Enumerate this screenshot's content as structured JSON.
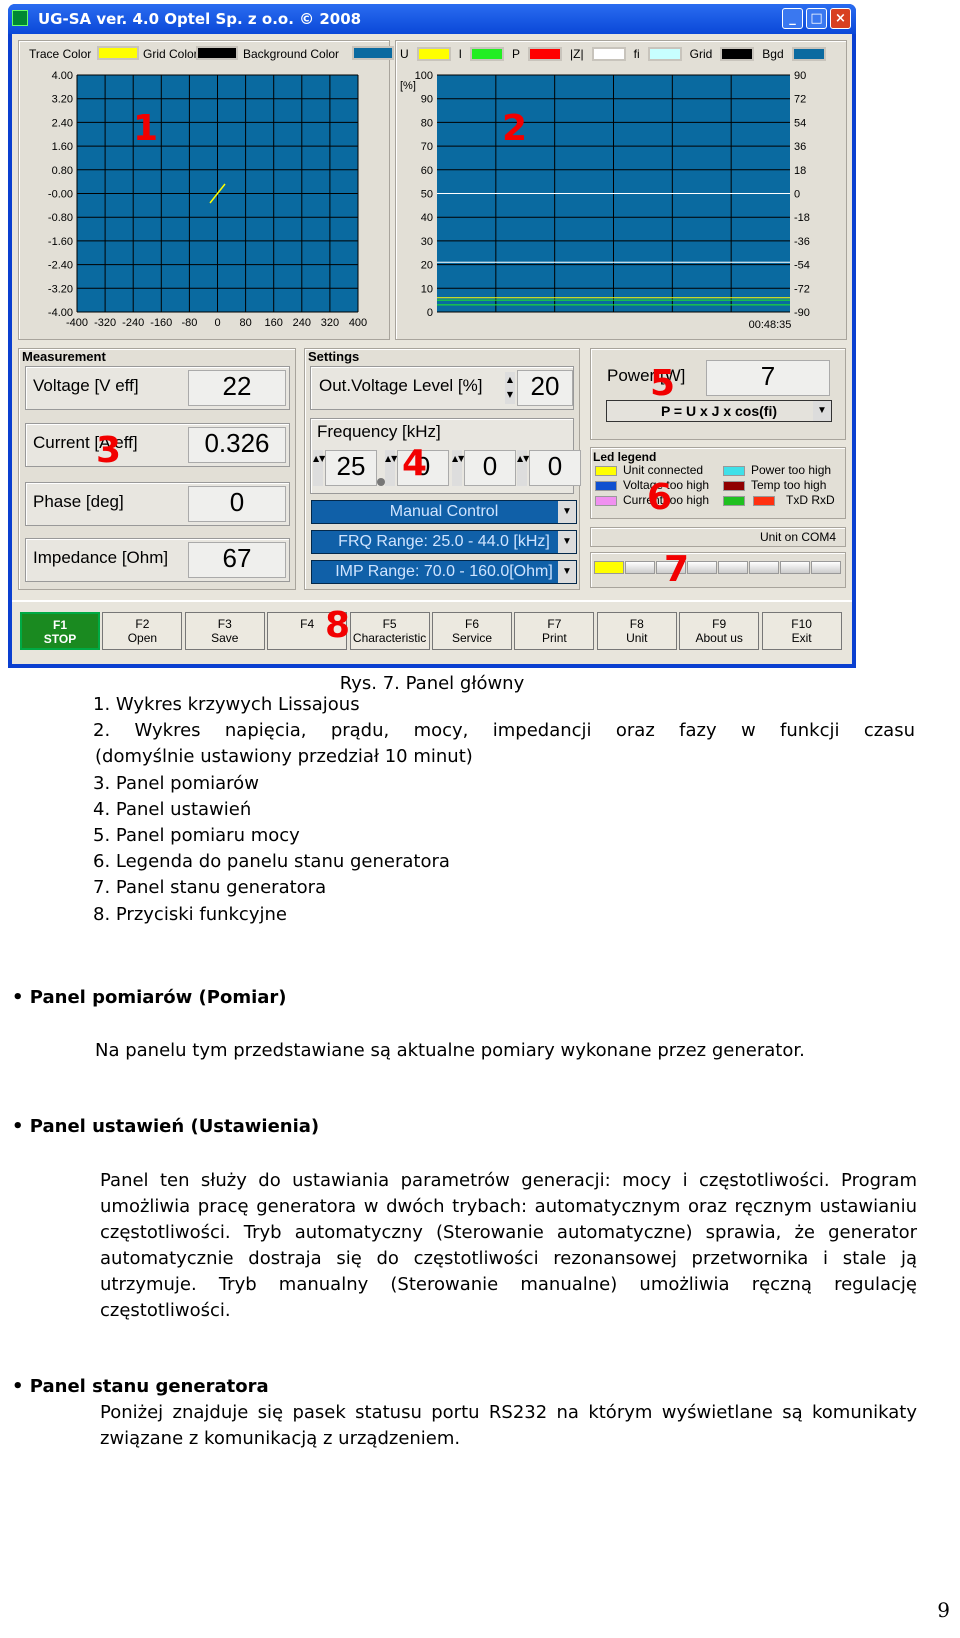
{
  "window": {
    "title": "UG-SA ver. 4.0  Optel Sp. z o.o. © 2008",
    "buttons": [
      "_",
      "□",
      "×"
    ]
  },
  "lissajous": {
    "labels": {
      "trace": "Trace Color",
      "grid": "Grid Color",
      "background": "Background Color"
    },
    "colors": {
      "trace": "#ffff00",
      "grid": "#000000",
      "background": "#0a6aa0"
    },
    "y_ticks": [
      "4.00",
      "3.20",
      "2.40",
      "1.60",
      "0.80",
      "-0.00",
      "-0.80",
      "-1.60",
      "-2.40",
      "-3.20",
      "-4.00"
    ],
    "x_ticks": [
      "-400",
      "-320",
      "-240",
      "-160",
      "-80",
      "0",
      "80",
      "160",
      "240",
      "320",
      "400"
    ]
  },
  "timeplot": {
    "legend": [
      {
        "label": "U",
        "color": "#ffff00"
      },
      {
        "label": "I",
        "color": "#22ee22"
      },
      {
        "label": "P",
        "color": "#ff0000"
      },
      {
        "label": "|Z|",
        "color": "#ffffff"
      },
      {
        "label": "fi",
        "color": "#c8ffff"
      },
      {
        "label": "Grid",
        "color": "#000000"
      },
      {
        "label": "Bgd",
        "color": "#0a6aa0"
      }
    ],
    "unit": "[%]",
    "left_ticks": [
      "100",
      "90",
      "80",
      "70",
      "60",
      "50",
      "40",
      "30",
      "20",
      "10",
      "0"
    ],
    "right_ticks": [
      "90",
      "72",
      "54",
      "36",
      "18",
      "0",
      "-18",
      "-36",
      "-54",
      "-72",
      "-90"
    ],
    "time": "00:48:35"
  },
  "measurement": {
    "title": "Measurement",
    "rows": [
      {
        "label": "Voltage [V eff]",
        "value": "22"
      },
      {
        "label": "Current [A eff]",
        "value": "0.326"
      },
      {
        "label": "Phase [deg]",
        "value": "0"
      },
      {
        "label": "Impedance [Ohm]",
        "value": "67"
      }
    ]
  },
  "settings": {
    "title": "Settings",
    "out_label": "Out.Voltage Level [%]",
    "out_value": "20",
    "freq_label": "Frequency [kHz]",
    "freq_digits": [
      "25",
      "0",
      "0",
      "0"
    ],
    "mode": "Manual Control",
    "frq_range": "FRQ Range: 25.0 - 44.0 [kHz]",
    "imp_range": "IMP Range: 70.0 - 160.0[Ohm]"
  },
  "power": {
    "label": "Power [W]",
    "value": "7",
    "formula": "P = U x J x cos(fi)"
  },
  "led_legend": {
    "title": "Led legend",
    "items": [
      {
        "label": "Unit connected",
        "color": "#ffff00"
      },
      {
        "label": "Voltage too high",
        "color": "#1050d0"
      },
      {
        "label": "Current too high",
        "color": "#f090f0"
      },
      {
        "label": "Power too high",
        "color": "#40e0e8"
      },
      {
        "label": "Temp too high",
        "color": "#900000"
      },
      {
        "label": "TxD RxD",
        "color": "#ff3010"
      }
    ],
    "extra_color": "#20c020"
  },
  "status": {
    "port": "Unit on COM4",
    "leds": [
      "#ffff00",
      "#eeeeee",
      "#eeeeee",
      "#eeeeee",
      "#eeeeee",
      "#eeeeee",
      "#eeeeee",
      "#eeeeee"
    ]
  },
  "fkeys": [
    {
      "k": "F1",
      "l": "STOP"
    },
    {
      "k": "F2",
      "l": "Open"
    },
    {
      "k": "F3",
      "l": "Save"
    },
    {
      "k": "F4",
      "l": ""
    },
    {
      "k": "F5",
      "l": "Characteristic"
    },
    {
      "k": "F6",
      "l": "Service"
    },
    {
      "k": "F7",
      "l": "Print"
    },
    {
      "k": "F8",
      "l": "Unit"
    },
    {
      "k": "F9",
      "l": "About us"
    },
    {
      "k": "F10",
      "l": "Exit"
    }
  ],
  "annotations": [
    "1",
    "2",
    "3",
    "4",
    "5",
    "6",
    "7",
    "8"
  ],
  "doc": {
    "caption": "Rys. 7. Panel główny",
    "list": [
      "1.  Wykres krzywych Lissajous",
      "2.  Wykres napięcia, prądu, mocy, impedancji oraz fazy w funkcji czasu",
      "(domyślnie ustawiony przedział 10 minut)",
      "3.  Panel pomiarów",
      "4.  Panel ustawień",
      "5.  Panel pomiaru mocy",
      "6.  Legenda do panelu stanu generatora",
      "7.  Panel stanu generatora",
      "8.  Przyciski funkcyjne"
    ],
    "h1": "Panel pomiarów (Pomiar)",
    "p1": "Na panelu tym przedstawiane są aktualne pomiary wykonane przez generator.",
    "h2": "Panel ustawień (Ustawienia)",
    "p2": "Panel ten służy do ustawiania parametrów generacji: mocy i częstotliwości. Program umożliwia pracę generatora w dwóch trybach: automatycznym oraz ręcznym ustawianiu częstotliwości. Tryb automatyczny (Sterowanie automatyczne) sprawia, że generator automatycznie dostraja się do częstotliwości rezonansowej przetwornika i stale ją utrzymuje. Tryb manualny (Sterowanie manualne) umożliwia ręczną regulację częstotliwości.",
    "h3": "Panel stanu generatora",
    "p3": "Poniżej znajduje się pasek statusu portu RS232 na którym wyświetlane są komunikaty  związane z komunikacją z urządzeniem.",
    "page": "9"
  }
}
